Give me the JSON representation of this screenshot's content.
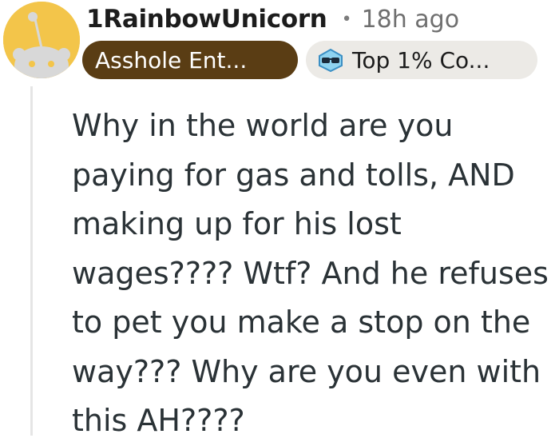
{
  "comment": {
    "author": "1RainbowUnicorn",
    "separator": "•",
    "time_ago": "18h ago",
    "user_flair": "Asshole Ent...",
    "badge": {
      "icon": "sunglasses-badge-icon",
      "label": "Top 1% Co..."
    },
    "body_lines": [
      "Why in the world are you",
      "paying for gas and tolls, AND",
      "making up for his lost",
      "wages???? Wtf? And he refuses",
      "to pet you make a stop on the",
      "way??? Why are you even with",
      "this AH????"
    ]
  },
  "colors": {
    "avatar_bg": "#f3c54a",
    "user_flair_bg": "#5a3d14",
    "badge_bg": "#eceae6",
    "thread_line": "#e5e5e5",
    "body_text": "#2a3236"
  }
}
